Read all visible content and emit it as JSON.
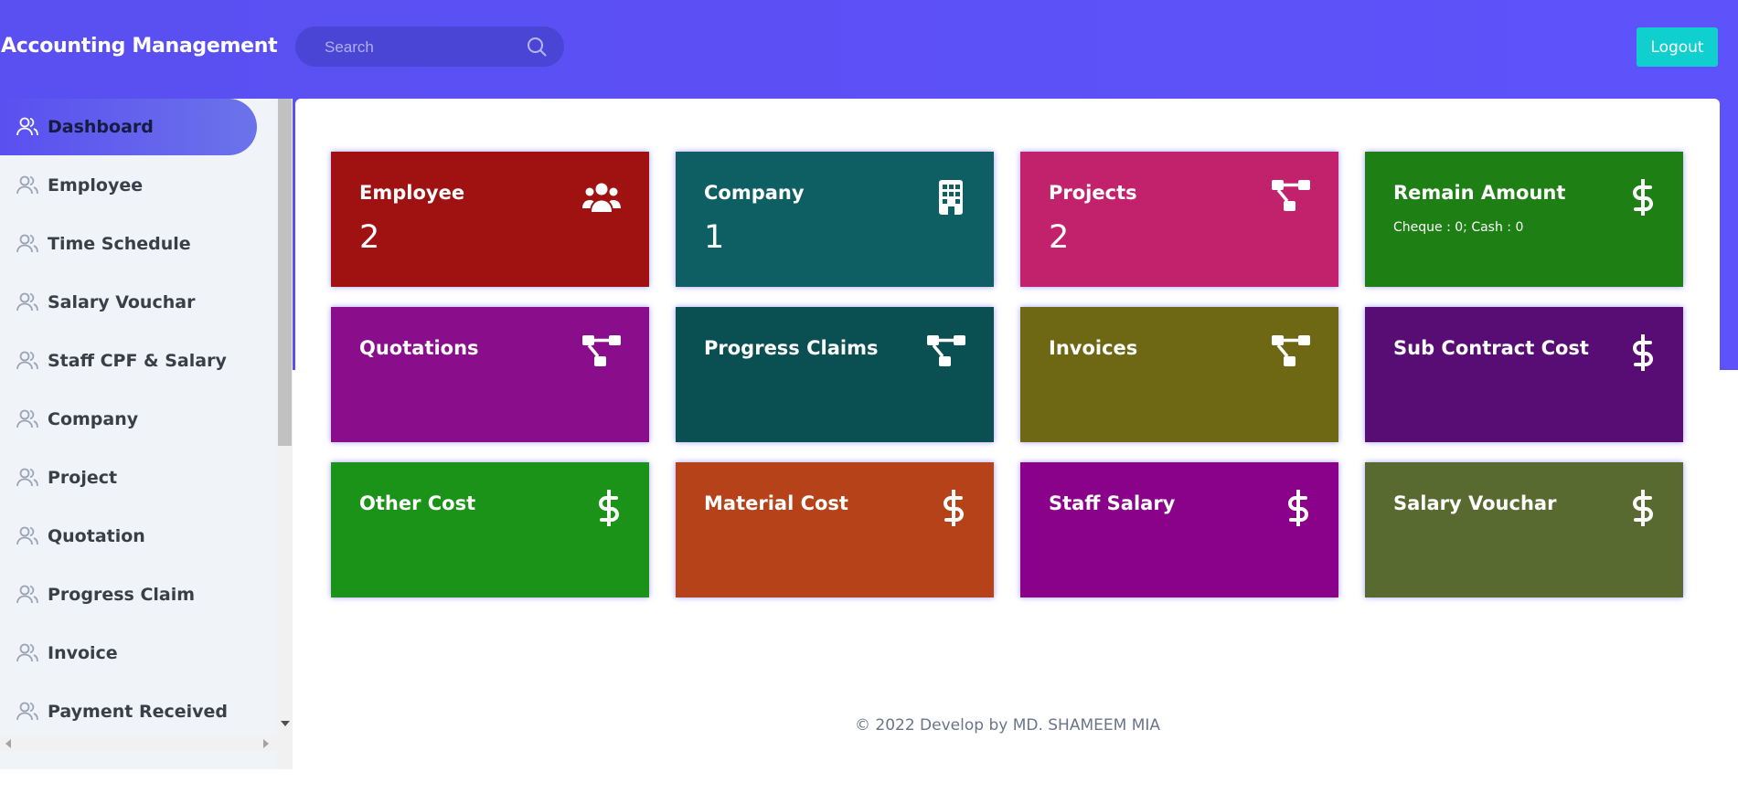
{
  "app": {
    "title": "Accounting Management"
  },
  "search": {
    "placeholder": "Search"
  },
  "header": {
    "logout_label": "Logout"
  },
  "sidebar": {
    "items": [
      {
        "label": "Dashboard",
        "active": true
      },
      {
        "label": "Employee"
      },
      {
        "label": "Time Schedule"
      },
      {
        "label": "Salary Vouchar"
      },
      {
        "label": "Staff CPF & Salary"
      },
      {
        "label": "Company"
      },
      {
        "label": "Project"
      },
      {
        "label": "Quotation"
      },
      {
        "label": "Progress Claim"
      },
      {
        "label": "Invoice"
      },
      {
        "label": "Payment Received"
      }
    ]
  },
  "cards": [
    {
      "title": "Employee",
      "value": "2",
      "icon": "users-icon",
      "color": "#a01212"
    },
    {
      "title": "Company",
      "value": "1",
      "icon": "building-icon",
      "color": "#0e5f63"
    },
    {
      "title": "Projects",
      "value": "2",
      "icon": "sitemap-icon",
      "color": "#c2226c"
    },
    {
      "title": "Remain Amount",
      "sub": "Cheque : 0; Cash : 0",
      "icon": "dollar-icon",
      "color": "#1d7f14"
    },
    {
      "title": "Quotations",
      "icon": "sitemap-icon",
      "color": "#8a0e8c"
    },
    {
      "title": "Progress Claims",
      "icon": "sitemap-icon",
      "color": "#0a4f52"
    },
    {
      "title": "Invoices",
      "icon": "sitemap-icon",
      "color": "#6e6814"
    },
    {
      "title": "Sub Contract Cost",
      "icon": "dollar-icon",
      "color": "#570d73"
    },
    {
      "title": "Other Cost",
      "icon": "dollar-icon",
      "color": "#1a9318"
    },
    {
      "title": "Material Cost",
      "icon": "dollar-icon",
      "color": "#b6421a"
    },
    {
      "title": "Staff Salary",
      "icon": "dollar-icon",
      "color": "#890289"
    },
    {
      "title": "Salary Vouchar",
      "icon": "dollar-icon",
      "color": "#586a30"
    }
  ],
  "footer": {
    "text": "© 2022 Develop by MD. SHAMEEM MIA"
  }
}
